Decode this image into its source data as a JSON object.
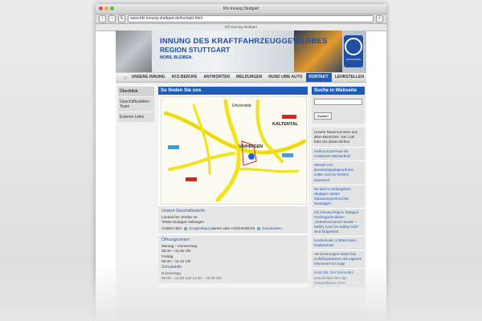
{
  "browser": {
    "window_title": "Kfz-Innung Stuttgart",
    "url": "www.kfz-innung-stuttgart.de/kontakt.html",
    "bookmarks_title": "Kfz-Innung Stuttgart"
  },
  "header": {
    "title": "INNUNG DES KRAFTFAHRZEUGGEWERBES",
    "subtitle": "REGION STUTTGART",
    "slogan": "MOBIL BLEIBEN.",
    "badge_text": "KFZ-INNUNG"
  },
  "nav": {
    "items": [
      "UNSERE INNUNG",
      "KFZ-BERUFE",
      "ANTWORTEN",
      "MELDUNGEN",
      "RUND UMS AUTO",
      "KONTAKT",
      "LEHRSTELLEN"
    ],
    "active": "KONTAKT"
  },
  "left_menu": {
    "items": [
      "Überblick",
      "Geschäftsstellen Team",
      "Externe Links"
    ]
  },
  "main": {
    "heading": "So finden Sie uns",
    "office_heading": "Unsere Geschäftsstelle:",
    "address_street": "Lombacher Straße 22",
    "address_city": "70563 Stuttgart-Vaihingen",
    "directions_prefix": "Anfahrt über",
    "directions_link1": "GoogleMaps",
    "directions_mid": "planen oder Anfahrtsskizze",
    "directions_link2": "downloaden.",
    "hours_heading": "Öffnungszeiten:",
    "hours_days1": "Montag – Donnerstag",
    "hours_time1": "08.00 – 16.45 Uhr",
    "hours_days2": "Freitag",
    "hours_time2": "08.00 – 15.15 Uhr",
    "school_heading": "Schulstelle",
    "school_days": "Donnerstag",
    "school_time": "09.00 – 12.00 und 14.00 – 16.00 Uhr"
  },
  "map": {
    "labels": [
      "Universität",
      "KALTENTAL",
      "VAIHINGEN"
    ]
  },
  "sidebar": {
    "search_heading": "Suche in Webseite",
    "search_button": "Suchen",
    "news_intro": "Unsere News kommen aus allen Bereichen. Der Link führt Sie direkt dorthin:",
    "news": [
      "Helmut Kussmaul mit Goldenem Meisterbrief",
      "Meister-HU: Bundestagsabgeordnete sollen sich für Reform einsetzen",
      "So kann's weitergehen: Stuttgart meldet Zulassungsrekord bei Neuwagen",
      "Kfz-Innung Region Stuttgart Kindergartenaktion „Verkehrssicherer Kinder – Safety Cars for Safety Kids\" wird fortgesetzt",
      "Kostenloser Lichttest beim Radwechsel",
      "Versicherungen haben bei Unfallreparaturen die eigenen Interessen im Auge",
      "Kreis BB: Der Dezember entscheidet über die Gesamtbilanz 2012"
    ]
  },
  "colors": {
    "accent": "#1f5cb8",
    "page_bg": "#f2f2f2",
    "road": "#f3e21b"
  }
}
